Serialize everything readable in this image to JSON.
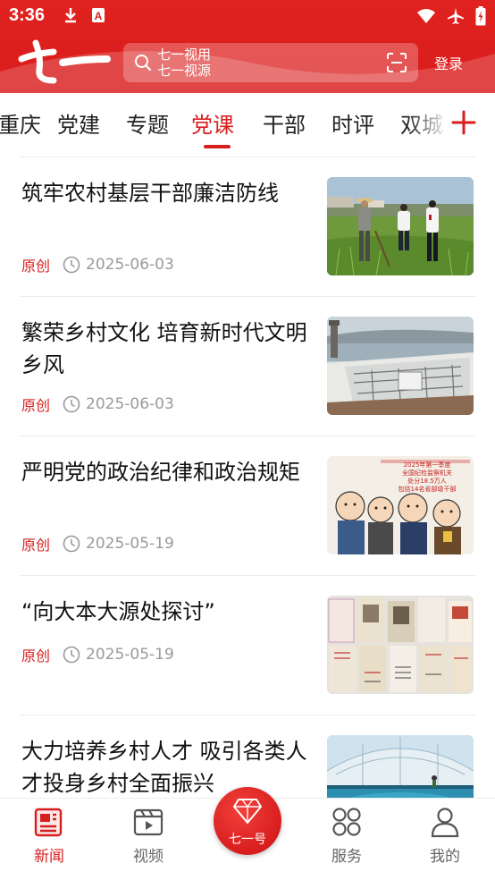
{
  "status_bar": {
    "time": "3:36",
    "icons": [
      "download-icon",
      "a-icon",
      "wifi-icon",
      "airplane-icon",
      "battery-charging-icon"
    ]
  },
  "header": {
    "logo_text": "七一",
    "search_placeholder": "七一视用\n七一视源",
    "login_label": "登录"
  },
  "tabs": [
    {
      "label": "重庆",
      "active": false
    },
    {
      "label": "党建",
      "active": false
    },
    {
      "label": "专题",
      "active": false
    },
    {
      "label": "党课",
      "active": true
    },
    {
      "label": "干部",
      "active": false
    },
    {
      "label": "时评",
      "active": false
    },
    {
      "label": "双城",
      "active": false
    }
  ],
  "articles": [
    {
      "title": "筑牢农村基层干部廉洁防线",
      "source": "原创",
      "date": "2025-06-03",
      "image": "farmland-officials-photo"
    },
    {
      "title": "繁荣乡村文化 培育新时代文明乡风",
      "source": "原创",
      "date": "2025-06-03",
      "image": "lakeside-village-photo"
    },
    {
      "title": "严明党的政治纪律和政治规矩",
      "source": "原创",
      "date": "2025-05-19",
      "image": "discipline-cartoon-photo"
    },
    {
      "title": "“向大本大源处探讨”",
      "source": "原创",
      "date": "2025-05-19",
      "image": "old-books-photo"
    },
    {
      "title": "大力培养乡村人才 吸引各类人才投身乡村全面振兴",
      "source": "",
      "date": "",
      "image": "greenhouse-fish-farm-photo"
    }
  ],
  "cartoon_text": [
    "2025年第一季度",
    "全国纪检监察机关",
    "处分18.5万人",
    "包括14名省部级干部"
  ],
  "bottom_nav": [
    {
      "label": "新闻",
      "icon": "news-icon",
      "active": true
    },
    {
      "label": "视频",
      "icon": "video-icon",
      "active": false
    },
    {
      "label": "七一号",
      "icon": "gem-icon",
      "active": false
    },
    {
      "label": "服务",
      "icon": "grid-icon",
      "active": false
    },
    {
      "label": "我的",
      "icon": "user-icon",
      "active": false
    }
  ],
  "colors": {
    "brand_red": "#d81e1e",
    "text": "#111111",
    "muted": "#9a9a9a"
  }
}
